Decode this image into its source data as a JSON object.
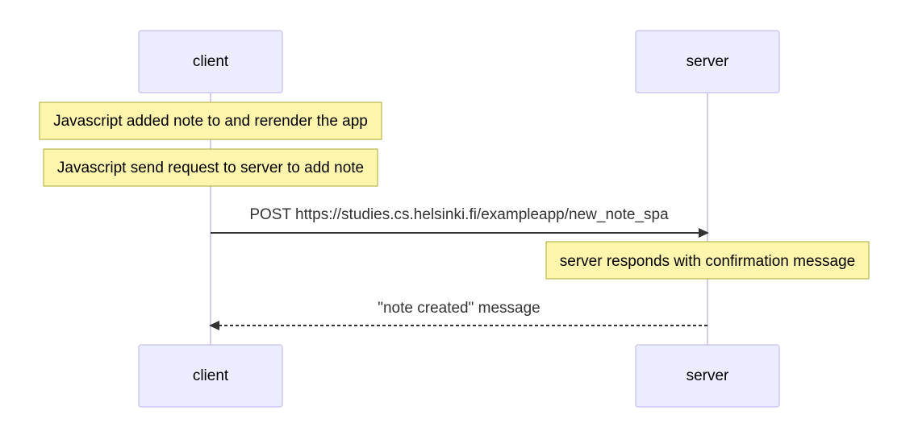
{
  "participants": [
    {
      "id": "client",
      "label": "client"
    },
    {
      "id": "server",
      "label": "server"
    }
  ],
  "notes": [
    {
      "text": "Javascript added note to and rerender the app"
    },
    {
      "text": "Javascript send request to server to add note"
    },
    {
      "text": "server responds with confirmation message"
    }
  ],
  "messages": [
    {
      "text": "POST https://studies.cs.helsinki.fi/exampleapp/new_note_spa",
      "style": "solid"
    },
    {
      "text": "\"note created\" message",
      "style": "dashed"
    }
  ]
}
